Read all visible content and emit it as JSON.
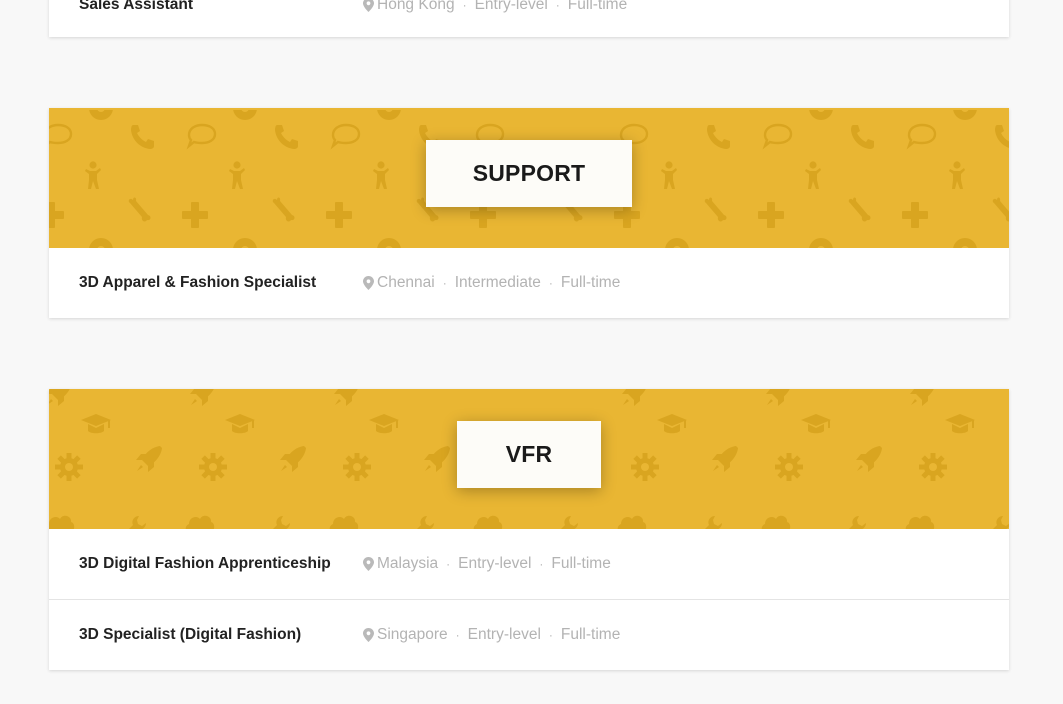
{
  "groups": [
    {
      "jobs": [
        {
          "title": "Sales Assistant",
          "location": "Hong Kong",
          "level": "Entry-level",
          "type": "Full-time"
        }
      ]
    },
    {
      "name": "SUPPORT",
      "jobs": [
        {
          "title": "3D Apparel & Fashion Specialist",
          "location": "Chennai",
          "level": "Intermediate",
          "type": "Full-time"
        }
      ]
    },
    {
      "name": "VFR",
      "jobs": [
        {
          "title": "3D Digital Fashion Apprenticeship",
          "location": "Malaysia",
          "level": "Entry-level",
          "type": "Full-time"
        },
        {
          "title": "3D Specialist (Digital Fashion)",
          "location": "Singapore",
          "level": "Entry-level",
          "type": "Full-time"
        }
      ]
    }
  ],
  "icons": {
    "location": "map-pin-icon"
  },
  "colors": {
    "banner": "#e9b633",
    "pattern": "#d9a520",
    "meta_text": "#b3b3b3",
    "title_text": "#222222"
  }
}
